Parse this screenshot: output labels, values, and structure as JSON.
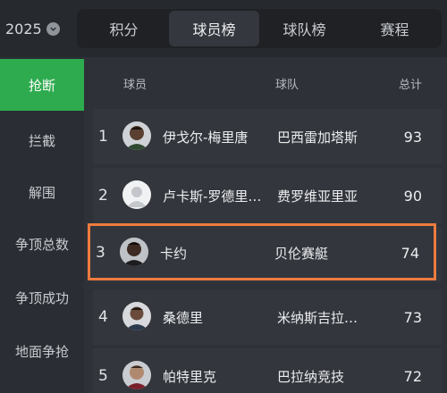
{
  "header": {
    "season": "2025",
    "tabs": [
      {
        "label": "积分"
      },
      {
        "label": "球员榜"
      },
      {
        "label": "球队榜"
      },
      {
        "label": "赛程"
      }
    ]
  },
  "sidebar": {
    "items": [
      {
        "label": "抢断"
      },
      {
        "label": "拦截"
      },
      {
        "label": "解围"
      },
      {
        "label": "争顶总数"
      },
      {
        "label": "争顶成功"
      },
      {
        "label": "地面争抢"
      }
    ]
  },
  "table": {
    "headers": {
      "player": "球员",
      "team": "球队",
      "total": "总计"
    },
    "rows": [
      {
        "rank": "1",
        "player": "伊戈尔-梅里唐",
        "team": "巴西雷加塔斯",
        "total": "93"
      },
      {
        "rank": "2",
        "player": "卢卡斯-罗德里…",
        "team": "费罗维亚里亚",
        "total": "90"
      },
      {
        "rank": "3",
        "player": "卡约",
        "team": "贝伦赛艇",
        "total": "74"
      },
      {
        "rank": "4",
        "player": "桑德里",
        "team": "米纳斯吉拉…",
        "total": "73"
      },
      {
        "rank": "5",
        "player": "帕特里克",
        "team": "巴拉纳竞技",
        "total": "72"
      }
    ]
  },
  "colors": {
    "accent_green": "#2eab4f",
    "highlight_orange": "#ee7b3f"
  }
}
